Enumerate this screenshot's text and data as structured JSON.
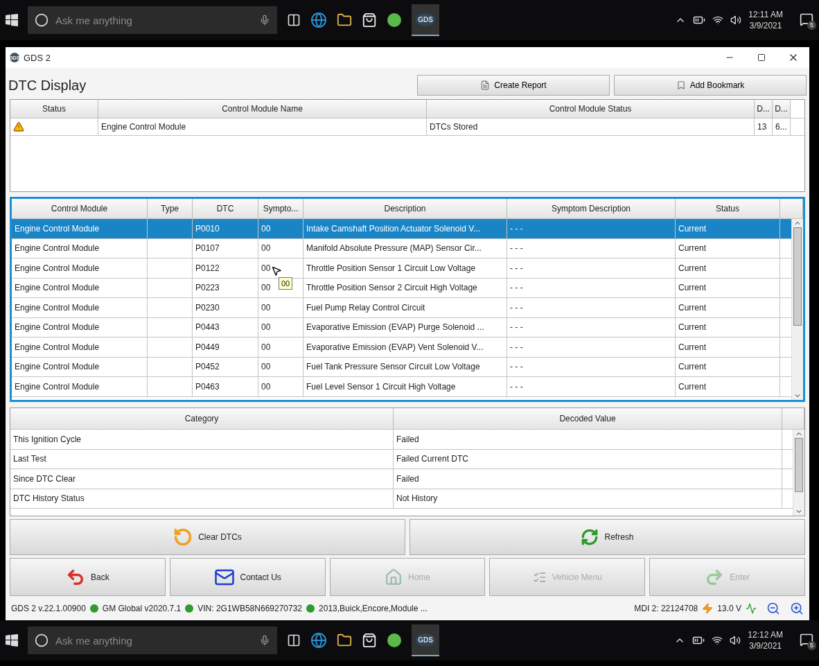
{
  "taskbars": [
    {
      "search_placeholder": "Ask me anything",
      "app_logo": "GDS",
      "time": "12:11 AM",
      "date": "3/9/2021",
      "notifications": "5"
    },
    {
      "search_placeholder": "Ask me anything",
      "app_logo": "GDS",
      "time": "12:12 AM",
      "date": "3/9/2021",
      "notifications": "5"
    }
  ],
  "window": {
    "title": "GDS 2",
    "logo": "GDS"
  },
  "toolbar": {
    "title": "DTC Display",
    "buttons": [
      "Create Report",
      "Add Bookmark"
    ]
  },
  "modules_table": {
    "columns": [
      "Status",
      "Control Module Name",
      "Control Module Status",
      "D...",
      "D..."
    ],
    "rows": [
      {
        "kind": "warning",
        "cells": [
          "",
          "Engine Control Module",
          "DTCs Stored",
          "13",
          "6..."
        ]
      }
    ]
  },
  "dtc_table": {
    "columns": [
      "Control Module",
      "Type",
      "DTC",
      "Sympto...",
      "Description",
      "Symptom Description",
      "Status"
    ],
    "rows": [
      {
        "selected": true,
        "cells": [
          "Engine Control Module",
          "",
          "P0010",
          "00",
          "Intake Camshaft Position Actuator Solenoid V...",
          "- - -",
          "Current"
        ]
      },
      {
        "selected": false,
        "cells": [
          "Engine Control Module",
          "",
          "P0107",
          "00",
          "Manifold Absolute Pressure (MAP) Sensor Cir...",
          "- - -",
          "Current"
        ]
      },
      {
        "selected": false,
        "cells": [
          "Engine Control Module",
          "",
          "P0122",
          "00",
          "Throttle Position Sensor 1 Circuit Low Voltage",
          "- - -",
          "Current"
        ]
      },
      {
        "selected": false,
        "cells": [
          "Engine Control Module",
          "",
          "P0223",
          "00",
          "Throttle Position Sensor 2 Circuit High Voltage",
          "- - -",
          "Current"
        ]
      },
      {
        "selected": false,
        "cells": [
          "Engine Control Module",
          "",
          "P0230",
          "00",
          "Fuel Pump Relay Control Circuit",
          "- - -",
          "Current"
        ]
      },
      {
        "selected": false,
        "cells": [
          "Engine Control Module",
          "",
          "P0443",
          "00",
          "Evaporative Emission (EVAP) Purge Solenoid ...",
          "- - -",
          "Current"
        ]
      },
      {
        "selected": false,
        "cells": [
          "Engine Control Module",
          "",
          "P0449",
          "00",
          "Evaporative Emission (EVAP) Vent Solenoid V...",
          "- - -",
          "Current"
        ]
      },
      {
        "selected": false,
        "cells": [
          "Engine Control Module",
          "",
          "P0452",
          "00",
          "Fuel Tank Pressure Sensor Circuit Low Voltage",
          "- - -",
          "Current"
        ]
      },
      {
        "selected": false,
        "cells": [
          "Engine Control Module",
          "",
          "P0463",
          "00",
          "Fuel Level Sensor 1 Circuit High Voltage",
          "- - -",
          "Current"
        ]
      }
    ],
    "tooltip": "00"
  },
  "category_table": {
    "columns": [
      "Category",
      "Decoded Value"
    ],
    "rows": [
      [
        "This Ignition Cycle",
        "Failed"
      ],
      [
        "Last Test",
        "Failed Current DTC"
      ],
      [
        "Since DTC Clear",
        "Failed"
      ],
      [
        "DTC History Status",
        "Not History"
      ]
    ]
  },
  "actions": [
    {
      "kind": "clear",
      "label": "Clear DTCs"
    },
    {
      "kind": "refresh",
      "label": "Refresh"
    }
  ],
  "nav": [
    {
      "kind": "back",
      "label": "Back",
      "disabled": false
    },
    {
      "kind": "contact",
      "label": "Contact Us",
      "disabled": false
    },
    {
      "kind": "home",
      "label": "Home",
      "disabled": true
    },
    {
      "kind": "vehicle",
      "label": "Vehicle Menu",
      "disabled": true
    },
    {
      "kind": "enter",
      "label": "Enter",
      "disabled": true
    }
  ],
  "status_bar": {
    "items": [
      "GDS 2 v.22.1.00900",
      "GM Global v2020.7.1",
      "VIN: 2G1WB58N669270732",
      "2013,Buick,Encore,Module ..."
    ],
    "mdi": "MDI 2: 22124708",
    "voltage": "13.0 V"
  }
}
